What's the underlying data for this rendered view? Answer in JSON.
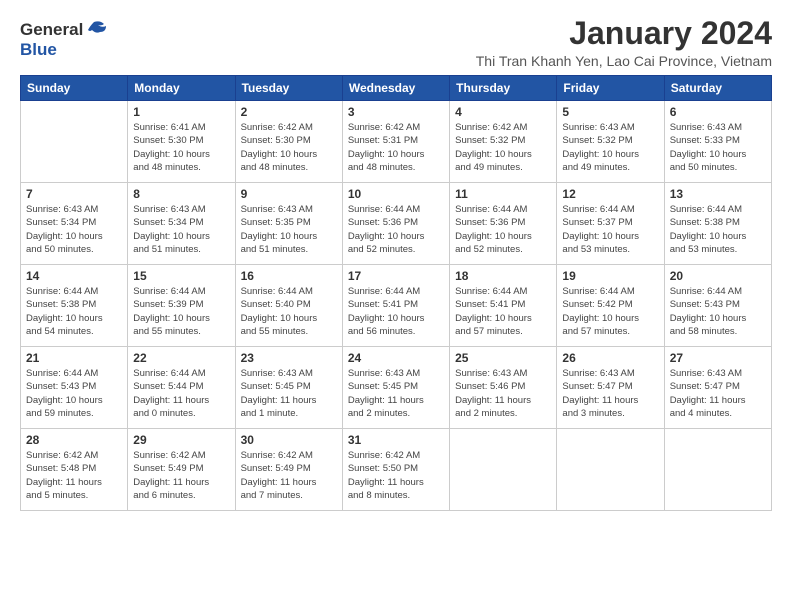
{
  "logo": {
    "general": "General",
    "blue": "Blue"
  },
  "header": {
    "month": "January 2024",
    "location": "Thi Tran Khanh Yen, Lao Cai Province, Vietnam"
  },
  "days_of_week": [
    "Sunday",
    "Monday",
    "Tuesday",
    "Wednesday",
    "Thursday",
    "Friday",
    "Saturday"
  ],
  "weeks": [
    [
      {
        "day": "",
        "info": ""
      },
      {
        "day": "1",
        "info": "Sunrise: 6:41 AM\nSunset: 5:30 PM\nDaylight: 10 hours\nand 48 minutes."
      },
      {
        "day": "2",
        "info": "Sunrise: 6:42 AM\nSunset: 5:30 PM\nDaylight: 10 hours\nand 48 minutes."
      },
      {
        "day": "3",
        "info": "Sunrise: 6:42 AM\nSunset: 5:31 PM\nDaylight: 10 hours\nand 48 minutes."
      },
      {
        "day": "4",
        "info": "Sunrise: 6:42 AM\nSunset: 5:32 PM\nDaylight: 10 hours\nand 49 minutes."
      },
      {
        "day": "5",
        "info": "Sunrise: 6:43 AM\nSunset: 5:32 PM\nDaylight: 10 hours\nand 49 minutes."
      },
      {
        "day": "6",
        "info": "Sunrise: 6:43 AM\nSunset: 5:33 PM\nDaylight: 10 hours\nand 50 minutes."
      }
    ],
    [
      {
        "day": "7",
        "info": "Sunrise: 6:43 AM\nSunset: 5:34 PM\nDaylight: 10 hours\nand 50 minutes."
      },
      {
        "day": "8",
        "info": "Sunrise: 6:43 AM\nSunset: 5:34 PM\nDaylight: 10 hours\nand 51 minutes."
      },
      {
        "day": "9",
        "info": "Sunrise: 6:43 AM\nSunset: 5:35 PM\nDaylight: 10 hours\nand 51 minutes."
      },
      {
        "day": "10",
        "info": "Sunrise: 6:44 AM\nSunset: 5:36 PM\nDaylight: 10 hours\nand 52 minutes."
      },
      {
        "day": "11",
        "info": "Sunrise: 6:44 AM\nSunset: 5:36 PM\nDaylight: 10 hours\nand 52 minutes."
      },
      {
        "day": "12",
        "info": "Sunrise: 6:44 AM\nSunset: 5:37 PM\nDaylight: 10 hours\nand 53 minutes."
      },
      {
        "day": "13",
        "info": "Sunrise: 6:44 AM\nSunset: 5:38 PM\nDaylight: 10 hours\nand 53 minutes."
      }
    ],
    [
      {
        "day": "14",
        "info": "Sunrise: 6:44 AM\nSunset: 5:38 PM\nDaylight: 10 hours\nand 54 minutes."
      },
      {
        "day": "15",
        "info": "Sunrise: 6:44 AM\nSunset: 5:39 PM\nDaylight: 10 hours\nand 55 minutes."
      },
      {
        "day": "16",
        "info": "Sunrise: 6:44 AM\nSunset: 5:40 PM\nDaylight: 10 hours\nand 55 minutes."
      },
      {
        "day": "17",
        "info": "Sunrise: 6:44 AM\nSunset: 5:41 PM\nDaylight: 10 hours\nand 56 minutes."
      },
      {
        "day": "18",
        "info": "Sunrise: 6:44 AM\nSunset: 5:41 PM\nDaylight: 10 hours\nand 57 minutes."
      },
      {
        "day": "19",
        "info": "Sunrise: 6:44 AM\nSunset: 5:42 PM\nDaylight: 10 hours\nand 57 minutes."
      },
      {
        "day": "20",
        "info": "Sunrise: 6:44 AM\nSunset: 5:43 PM\nDaylight: 10 hours\nand 58 minutes."
      }
    ],
    [
      {
        "day": "21",
        "info": "Sunrise: 6:44 AM\nSunset: 5:43 PM\nDaylight: 10 hours\nand 59 minutes."
      },
      {
        "day": "22",
        "info": "Sunrise: 6:44 AM\nSunset: 5:44 PM\nDaylight: 11 hours\nand 0 minutes."
      },
      {
        "day": "23",
        "info": "Sunrise: 6:43 AM\nSunset: 5:45 PM\nDaylight: 11 hours\nand 1 minute."
      },
      {
        "day": "24",
        "info": "Sunrise: 6:43 AM\nSunset: 5:45 PM\nDaylight: 11 hours\nand 2 minutes."
      },
      {
        "day": "25",
        "info": "Sunrise: 6:43 AM\nSunset: 5:46 PM\nDaylight: 11 hours\nand 2 minutes."
      },
      {
        "day": "26",
        "info": "Sunrise: 6:43 AM\nSunset: 5:47 PM\nDaylight: 11 hours\nand 3 minutes."
      },
      {
        "day": "27",
        "info": "Sunrise: 6:43 AM\nSunset: 5:47 PM\nDaylight: 11 hours\nand 4 minutes."
      }
    ],
    [
      {
        "day": "28",
        "info": "Sunrise: 6:42 AM\nSunset: 5:48 PM\nDaylight: 11 hours\nand 5 minutes."
      },
      {
        "day": "29",
        "info": "Sunrise: 6:42 AM\nSunset: 5:49 PM\nDaylight: 11 hours\nand 6 minutes."
      },
      {
        "day": "30",
        "info": "Sunrise: 6:42 AM\nSunset: 5:49 PM\nDaylight: 11 hours\nand 7 minutes."
      },
      {
        "day": "31",
        "info": "Sunrise: 6:42 AM\nSunset: 5:50 PM\nDaylight: 11 hours\nand 8 minutes."
      },
      {
        "day": "",
        "info": ""
      },
      {
        "day": "",
        "info": ""
      },
      {
        "day": "",
        "info": ""
      }
    ]
  ]
}
